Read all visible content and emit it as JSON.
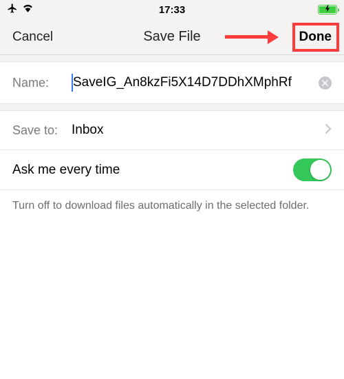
{
  "status": {
    "time": "17:33"
  },
  "header": {
    "cancel": "Cancel",
    "title": "Save File",
    "done": "Done"
  },
  "form": {
    "name_label": "Name:",
    "name_value": "SaveIG_An8kzFi5X14D7DDhXMphRf",
    "saveto_label": "Save to:",
    "saveto_value": "Inbox",
    "toggle_label": "Ask me every time",
    "toggle_on": true
  },
  "footer": {
    "hint": "Turn off to download files automatically in the selected folder."
  }
}
